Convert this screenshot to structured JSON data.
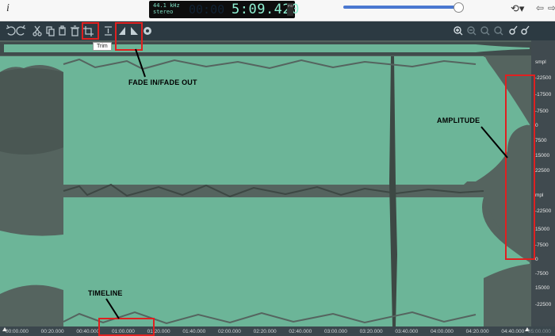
{
  "topbar": {
    "info_glyph": "i",
    "sample_rate": "44.1 kHz",
    "channels": "stereo",
    "ghost_digits": "00:00",
    "time_display": "5:09.420",
    "time_unit": "ms",
    "volume_level": 0.98,
    "history_glyph": "⟲▾",
    "back_glyph": "⇦",
    "forward_glyph": "⇨"
  },
  "toolbar": {
    "tooltip": "Trim",
    "left_icons": [
      "undo-icon",
      "redo-icon",
      "cut-icon",
      "copy-icon",
      "paste-icon",
      "delete-icon",
      "crop-icon",
      "silence-icon",
      "fade-in-icon",
      "fade-out-icon",
      "normalize-icon"
    ],
    "right_icons": [
      "zoom-in-icon",
      "zoom-out-icon",
      "zoom-selection-icon",
      "zoom-fit-icon",
      "zoom-in-amplitude-icon",
      "zoom-out-amplitude-icon"
    ]
  },
  "ruler": {
    "labels": [
      "smpl",
      "-22500",
      "-17500",
      "-7500",
      "0",
      "7500",
      "15000",
      "22500",
      "mpl",
      "-22500",
      "15000",
      "-7500",
      "0",
      "-7500",
      "15000",
      "-22500"
    ]
  },
  "timeline": {
    "labels": [
      "00:00.000",
      "00:20.000",
      "00:40.000",
      "01:00.000",
      "01:20.000",
      "01:40.000",
      "02:00.000",
      "02:20.000",
      "02:40.000",
      "03:00.000",
      "03:20.000",
      "03:40.000",
      "04:00.000",
      "04:20.000",
      "04:40.000",
      "05:00.000"
    ]
  },
  "annotations": {
    "fade": "FADE IN/FADE OUT",
    "amplitude": "AMPLITUDE",
    "timeline": "TIMELINE"
  },
  "colors": {
    "waveform": "#6cb598",
    "background": "#55645f",
    "highlight": "#e02020"
  }
}
